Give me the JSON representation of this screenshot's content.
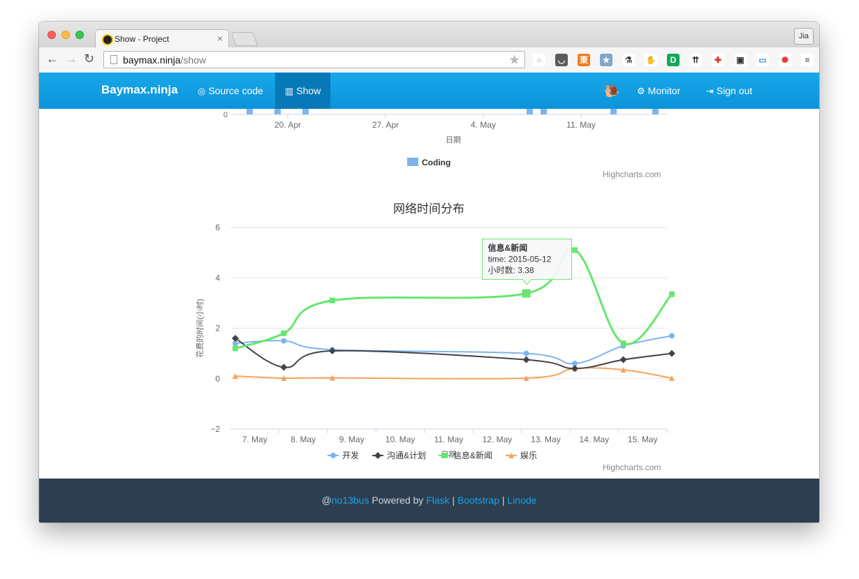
{
  "browser": {
    "tab_title": "Show - Project",
    "tab_close": "×",
    "profile": "Jia",
    "url_host": "baymax.ninja",
    "url_path": "/show",
    "back_glyph": "←",
    "forward_glyph": "→",
    "reload_glyph": "↻",
    "star_glyph": "★",
    "extensions": [
      "circle-icon",
      "pocket-icon",
      "evernote-clip-icon",
      "bookmark-star-icon",
      "syringe-icon",
      "elephant-icon",
      "translate-icon",
      "traffic-icon",
      "cross-icon",
      "image-icon",
      "folder-icon",
      "color-wheel-icon",
      "menu-icon"
    ]
  },
  "navbar": {
    "brand": "Baymax.ninja",
    "source_code": "Source code",
    "show": "Show",
    "monitor": "Monitor",
    "sign_out": "Sign out",
    "colors": {
      "bar": "#11a0e3",
      "active": "#0778b8"
    }
  },
  "chart_data": [
    {
      "type": "bar",
      "x_tick_labels": [
        "20. Apr",
        "27. Apr",
        "4. May",
        "11. May"
      ],
      "y_tick_labels": [
        "0"
      ],
      "xlabel": "日期",
      "series": [
        {
          "name": "Coding",
          "color": "#7cb5ec"
        }
      ],
      "legend": "bottom-center",
      "credit": "Highcharts.com"
    },
    {
      "type": "line",
      "title": "网络时间分布",
      "xlabel": "日期",
      "ylabel": "花费的时间(小时)",
      "ylim": [
        -2,
        6
      ],
      "y_ticks": [
        6,
        4,
        2,
        0,
        -2
      ],
      "y_tick_labels": [
        "6",
        "4",
        "2",
        "0",
        "−2"
      ],
      "categories": [
        "7. May",
        "8. May",
        "9. May",
        "10. May",
        "11. May",
        "12. May",
        "13. May",
        "14. May",
        "15. May"
      ],
      "x": [
        "2015-05-06",
        "2015-05-07",
        "2015-05-08",
        "2015-05-12",
        "2015-05-13",
        "2015-05-14",
        "2015-05-15"
      ],
      "series": [
        {
          "name": "开发",
          "color": "#7cb5ec",
          "marker": "circle",
          "values": [
            1.4,
            1.5,
            1.15,
            1.0,
            0.6,
            1.3,
            1.7
          ]
        },
        {
          "name": "沟通&计划",
          "color": "#434348",
          "marker": "diamond",
          "values": [
            1.6,
            0.45,
            1.1,
            0.75,
            0.4,
            0.75,
            1.0
          ]
        },
        {
          "name": "信息&新闻",
          "color": "#67e670",
          "marker": "square",
          "values": [
            1.2,
            1.8,
            3.1,
            3.38,
            5.1,
            1.4,
            3.35
          ]
        },
        {
          "name": "娱乐",
          "color": "#f7a35c",
          "marker": "triangle",
          "values": [
            0.1,
            0.02,
            0.03,
            0.02,
            0.4,
            0.35,
            0.02
          ]
        }
      ],
      "tooltip": {
        "series": "信息&新闻",
        "time_line": "time: 2015-05-12",
        "hours_line": "小时数: 3.38",
        "point_index": 3
      },
      "legend": "bottom-center",
      "credit": "Highcharts.com"
    }
  ],
  "footer": {
    "at": "@",
    "user": "no13bus",
    "powered_by": " Powered by ",
    "flask": "Flask",
    "sep": " | ",
    "bootstrap": "Bootstrap",
    "linode": "Linode"
  }
}
